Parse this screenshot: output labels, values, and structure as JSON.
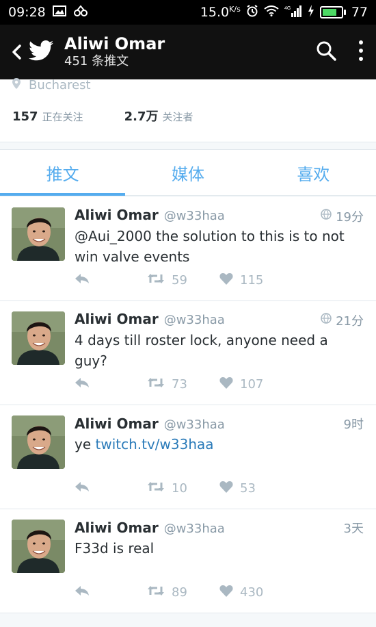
{
  "status_bar": {
    "time": "09:28",
    "speed": "15.0",
    "speed_unit": "K/s",
    "network_label": "4G",
    "battery_percent": 77,
    "battery_color": "#4cd964"
  },
  "header": {
    "name": "Aliwi Omar",
    "subtitle": "451 条推文",
    "icons": [
      "back-arrow-icon",
      "twitter-bird-icon",
      "search-icon",
      "more-vertical-icon"
    ]
  },
  "profile": {
    "location": "Bucharest",
    "following_count": "157",
    "following_label": "正在关注",
    "followers_count": "2.7万",
    "followers_label": "关注者"
  },
  "tabs": [
    {
      "label": "推文",
      "active": true
    },
    {
      "label": "媒体",
      "active": false
    },
    {
      "label": "喜欢",
      "active": false
    }
  ],
  "accent_color": "#55acee",
  "tweets": [
    {
      "name": "Aliwi Omar",
      "handle": "@w33haa",
      "time": "19分",
      "globe": true,
      "text": "@Aui_2000 the solution to this is to not win valve events",
      "retweets": "59",
      "likes": "115"
    },
    {
      "name": "Aliwi Omar",
      "handle": "@w33haa",
      "time": "21分",
      "globe": true,
      "text": "4 days till roster lock, anyone need a guy?",
      "retweets": "73",
      "likes": "107"
    },
    {
      "name": "Aliwi Omar",
      "handle": "@w33haa",
      "time": "9时",
      "globe": false,
      "text_prefix": "ye ",
      "link": "twitch.tv/w33haa",
      "retweets": "10",
      "likes": "53"
    },
    {
      "name": "Aliwi Omar",
      "handle": "@w33haa",
      "time": "3天",
      "globe": false,
      "text": "F33d is real",
      "retweets": "89",
      "likes": "430"
    }
  ]
}
